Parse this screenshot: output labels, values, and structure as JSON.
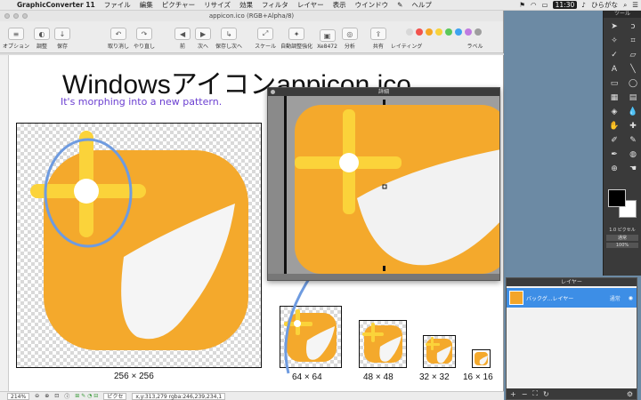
{
  "menubar": {
    "apple": "",
    "app": "GraphicConverter 11",
    "items": [
      "ファイル",
      "編集",
      "ピクチャー",
      "リサイズ",
      "効果",
      "フィルタ",
      "レイヤー",
      "表示",
      "ウインドウ",
      "",
      "ヘルプ"
    ],
    "clock": "11:30",
    "input": "ひらがな"
  },
  "window": {
    "title": "appicon.ico (RGB+Alpha/8)",
    "toolbar": [
      {
        "icon": "sliders-icon",
        "label": "オプション"
      },
      {
        "icon": "adjust-icon",
        "label": "調整"
      },
      {
        "icon": "save-icon",
        "label": "保存"
      },
      {
        "icon": "undo-icon",
        "label": "取り消し"
      },
      {
        "icon": "redo-icon",
        "label": "やり直し"
      },
      {
        "icon": "prev-icon",
        "label": "前"
      },
      {
        "icon": "next-icon",
        "label": "次へ"
      },
      {
        "icon": "save-next-icon",
        "label": "保存し次へ"
      },
      {
        "icon": "scale-icon",
        "label": "スケール"
      },
      {
        "icon": "auto-enhance-icon",
        "label": "自動調整強化"
      },
      {
        "icon": "size-icon",
        "label": "Xe8472"
      },
      {
        "icon": "analyze-icon",
        "label": "分析"
      },
      {
        "icon": "share-icon",
        "label": "共有"
      },
      {
        "icon": "layering-icon",
        "label": "レイティング"
      },
      {
        "icon": "label-icon",
        "label": "ラベル"
      }
    ],
    "label_colors": [
      "#d8d8d8",
      "#f2534d",
      "#f5a623",
      "#f8d23b",
      "#5ac85a",
      "#3ea2f0",
      "#c07ae0",
      "#9e9e9e"
    ]
  },
  "content": {
    "title": "Windowsアイコンappicon.ico",
    "subtitle": "It's morphing into a new pattern.",
    "icons": [
      {
        "label": "256 × 256"
      },
      {
        "label": "64 × 64"
      },
      {
        "label": "48 × 48"
      },
      {
        "label": "32 × 32"
      },
      {
        "label": "16 × 16"
      }
    ]
  },
  "zoom_window": {
    "title": "詳細"
  },
  "statusbar": {
    "zoom": "214%",
    "info_label": "ピクセ",
    "readout": "x,y:313,279 rgba:246,239,234,1"
  },
  "tool_palette": {
    "title": "ツール",
    "tools": [
      "select-arrow-icon",
      "lasso-icon",
      "magic-wand-icon",
      "crop-icon",
      "eyedropper-icon",
      "eraser-icon",
      "text-icon",
      "line-icon",
      "rect-icon",
      "ellipse-icon",
      "stamp-icon",
      "gradient-icon",
      "bucket-icon",
      "drop-icon",
      "smudge-icon",
      "bandage-icon",
      "brush-icon",
      "marker-icon",
      "pen-icon",
      "sponge-icon",
      "zoom-icon",
      "hand-icon"
    ],
    "size_label": "1.0 ピクセル",
    "mode_label": "通常",
    "opacity_label": "100%"
  },
  "layer_palette": {
    "title": "レイヤー",
    "row_label": "バックグ...レイヤー",
    "row_mode": "通常"
  }
}
